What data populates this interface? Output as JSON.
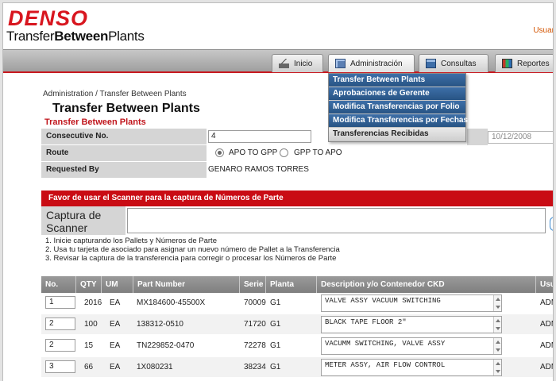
{
  "header": {
    "brand": "DENSO",
    "product_prefix": "Transfer",
    "product_bold": "Between",
    "product_suffix": "Plants",
    "user_link": "Usuar"
  },
  "menu": {
    "tabs": [
      {
        "label": "Inicio",
        "icon": "home-icon"
      },
      {
        "label": "Administración",
        "icon": "admin-icon"
      },
      {
        "label": "Consultas",
        "icon": "consultas-icon"
      },
      {
        "label": "Reportes",
        "icon": "reportes-icon"
      }
    ],
    "dropdown": [
      "Transfer Between Plants",
      "Aprobaciones de Gerente",
      "Modifica Transferencias por Folio",
      "Modifica Transferencias por Fechas",
      "Transferencias Recibidas"
    ]
  },
  "page": {
    "breadcrumb": "Administration / Transfer Between Plants",
    "title": "Transfer Between Plants",
    "subtitle": "Transfer Between Plants"
  },
  "form": {
    "consecutive_label": "Consecutive No.",
    "consecutive_value": "4",
    "date_value": "10/12/2008",
    "route_label": "Route",
    "route_option_1": "APO TO GPP",
    "route_option_2": "GPP TO APO",
    "requested_label": "Requested By",
    "requested_value": "GENARO RAMOS TORRES"
  },
  "scanner": {
    "banner": "Favor de usar el Scanner para la captura de Números de Parte",
    "label_line1": "Captura de",
    "label_line2": "Scanner",
    "instructions": [
      "1. Inicie capturando los Pallets y Números de Parte",
      "2. Usa tu tarjeta de asociado para asignar un nuevo número de Pallet a la Transferencia",
      "3. Revisar la captura de la transferencia para corregir o procesar los Números de Parte"
    ]
  },
  "table": {
    "headers": [
      "No.",
      "QTY",
      "UM",
      "Part Number",
      "Serie",
      "Planta",
      "Description y/o Contenedor CKD",
      "Usua"
    ],
    "rows": [
      {
        "no": "1",
        "qty": "2016",
        "um": "EA",
        "part": "MX184600-45500X",
        "serie": "70009",
        "planta": "G1",
        "desc": "VALVE ASSY VACUUM SWITCHING",
        "user": "ADMI"
      },
      {
        "no": "2",
        "qty": "100",
        "um": "EA",
        "part": "138312-0510",
        "serie": "71720",
        "planta": "G1",
        "desc": "BLACK TAPE FLOOR 2\"",
        "user": "ADMI"
      },
      {
        "no": "2",
        "qty": "15",
        "um": "EA",
        "part": "TN229852-0470",
        "serie": "72278",
        "planta": "G1",
        "desc": "VACUMM SWITCHING, VALVE ASSY",
        "user": "ADMI"
      },
      {
        "no": "3",
        "qty": "66",
        "um": "EA",
        "part": "1X080231",
        "serie": "38234",
        "planta": "G1",
        "desc": "METER ASSY, AIR FLOW CONTROL",
        "user": "ADMI"
      }
    ]
  }
}
